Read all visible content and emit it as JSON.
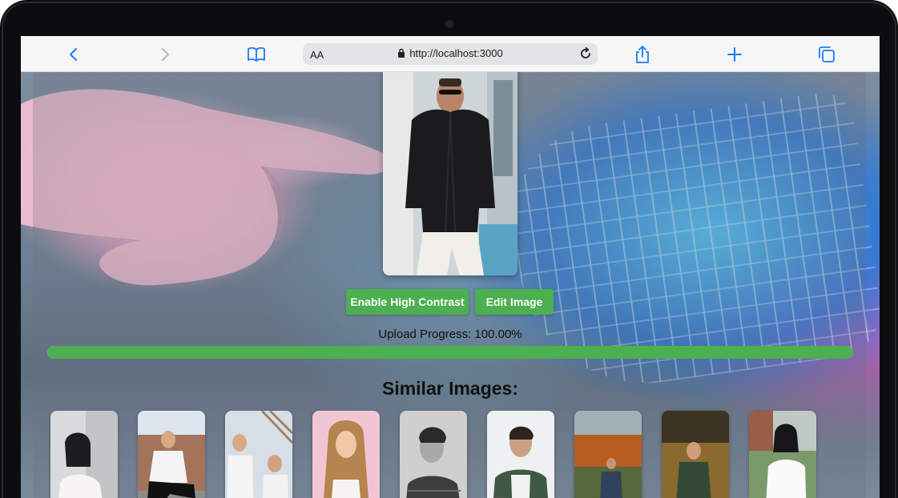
{
  "browser": {
    "address_aa": "AA",
    "url": "http://localhost:3000",
    "icons": [
      "back-icon",
      "forward-icon",
      "bookmarks-icon",
      "lock-icon",
      "reload-icon",
      "share-icon",
      "new-tab-icon",
      "tabs-icon"
    ]
  },
  "actions": {
    "high_contrast_label": "Enable High Contrast",
    "edit_label": "Edit Image"
  },
  "upload": {
    "progress_text": "Upload Progress: 100.00%",
    "progress_percent": 100
  },
  "similar": {
    "title": "Similar Images:",
    "thumbnails": [
      {
        "subject": "woman-white-top"
      },
      {
        "subject": "man-sitting-stairs"
      },
      {
        "subject": "couple-sunglasses"
      },
      {
        "subject": "woman-curly-hair"
      },
      {
        "subject": "man-black-white-portrait"
      },
      {
        "subject": "man-checked-shirt-phone"
      },
      {
        "subject": "man-autumn-park"
      },
      {
        "subject": "man-autumn-leaves"
      },
      {
        "subject": "woman-white-shirt"
      }
    ]
  },
  "colors": {
    "accent_green": "#4caf50",
    "progress_track": "#d0d0d0",
    "ios_blue": "#1a7cf2"
  }
}
